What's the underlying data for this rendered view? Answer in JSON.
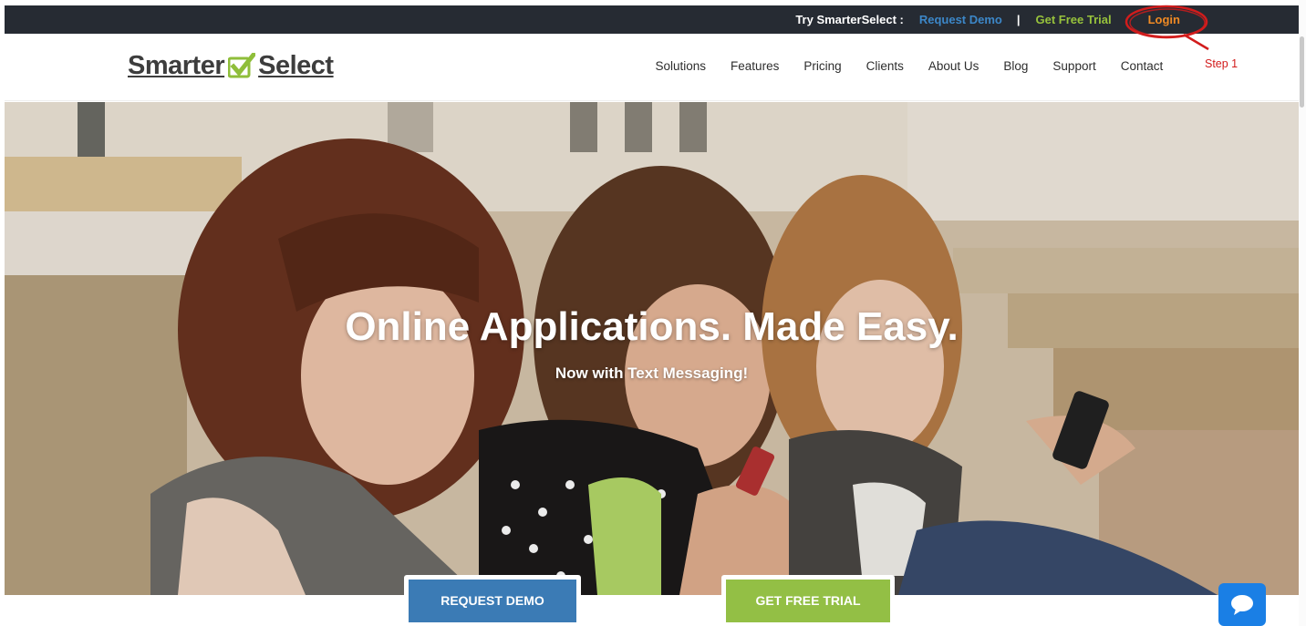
{
  "topbar": {
    "try_label": "Try SmarterSelect :",
    "request_demo": "Request Demo",
    "separator": "|",
    "free_trial": "Get Free Trial",
    "login": "Login"
  },
  "logo": {
    "part1": "Smarter",
    "part2": "Select"
  },
  "nav": {
    "items": [
      "Solutions",
      "Features",
      "Pricing",
      "Clients",
      "About Us",
      "Blog",
      "Support",
      "Contact"
    ]
  },
  "annotation": {
    "step_label": "Step 1"
  },
  "hero": {
    "title": "Online Applications. Made Easy.",
    "subtitle": "Now with Text Messaging!"
  },
  "cta": {
    "request_demo": "REQUEST DEMO",
    "free_trial": "GET FREE TRIAL"
  },
  "colors": {
    "topbar_bg": "#262b33",
    "demo_blue": "#3c87c8",
    "trial_green": "#97c23c",
    "login_orange": "#f08a24",
    "annotation_red": "#d21c1c",
    "chat_blue": "#1a7fe5"
  },
  "icons": {
    "logo_check": "checkbox-check-icon",
    "chat": "chat-bubble-icon"
  }
}
